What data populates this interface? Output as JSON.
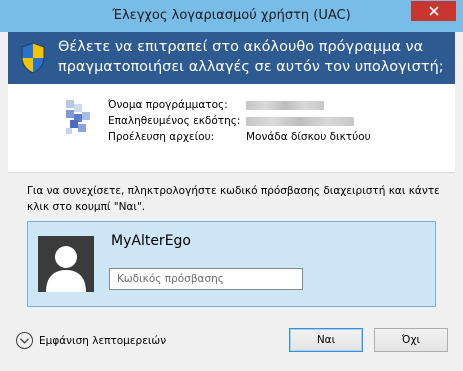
{
  "window": {
    "title": "Έλεγχος λογαριασμού χρήστη (UAC)"
  },
  "banner": {
    "message": "Θέλετε να επιτραπεί στο ακόλουθο πρόγραμμα να πραγματοποιήσει αλλαγές σε αυτόν τον υπολογιστή;",
    "icon": "uac-shield-icon"
  },
  "program_info": {
    "program_name_label": "Όνομα προγράμματος:",
    "program_name_value": "",
    "publisher_label": "Επαληθευμένος εκδότης:",
    "publisher_value": "",
    "origin_label": "Προέλευση αρχείου:",
    "origin_value": "Μονάδα δίσκου δικτύου"
  },
  "instruction": "Για να συνεχίσετε, πληκτρολογήστε κωδικό πρόσβασης διαχειριστή και κάντε κλικ στο κουμπί \"Ναι\".",
  "credential": {
    "username": "MyAlterEgo",
    "password_placeholder": "Κωδικός πρόσβασης",
    "password_value": ""
  },
  "footer": {
    "details_label": "Εμφάνιση λεπτομερειών",
    "yes_label": "Ναι",
    "no_label": "Όχι"
  },
  "colors": {
    "titlebar": "#78bde8",
    "banner": "#2d5a91",
    "close": "#c7372f",
    "tile": "#cce6f6"
  }
}
